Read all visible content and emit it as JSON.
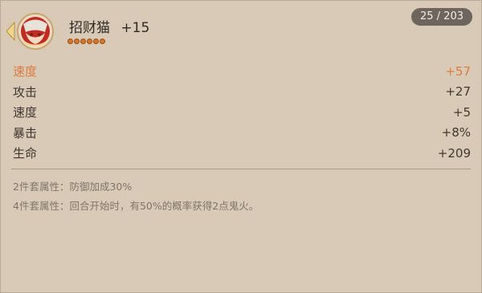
{
  "header": {
    "name": "招财猫",
    "level": "+15",
    "counter": "25 / 203",
    "stars": 6
  },
  "stats": [
    {
      "name": "速度",
      "value": "+57",
      "main": true
    },
    {
      "name": "攻击",
      "value": "+27",
      "main": false
    },
    {
      "name": "速度",
      "value": "+5",
      "main": false
    },
    {
      "name": "暴击",
      "value": "+8%",
      "main": false
    },
    {
      "name": "生命",
      "value": "+209",
      "main": false
    }
  ],
  "set_bonus": {
    "two": "2件套属性：防御加成30%",
    "four": "4件套属性：回合开始时，有50%的概率获得2点鬼火。"
  },
  "colors": {
    "background": "#d8cab7",
    "main_stat": "#e07a3e",
    "badge": "#6d655e"
  },
  "icons": {
    "portrait": "cat-spirit-portrait",
    "star": "flame-star-icon"
  }
}
